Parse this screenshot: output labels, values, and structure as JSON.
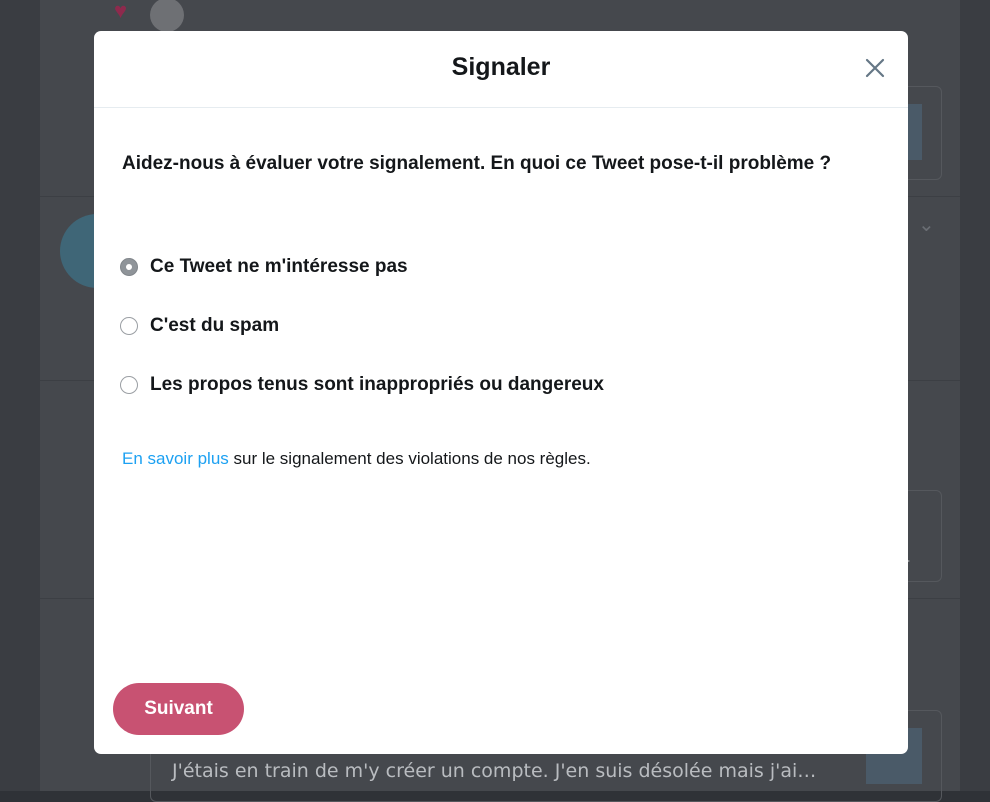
{
  "background": {
    "tweet_text": "J'étais en train de m'y créer un compte. J'en suis désolée mais j'ai…"
  },
  "modal": {
    "title": "Signaler",
    "question": "Aidez-nous à évaluer votre signalement. En quoi ce Tweet pose-t-il problème ?",
    "options": [
      {
        "label": "Ce Tweet ne m'intéresse pas",
        "selected": true
      },
      {
        "label": "C'est du spam",
        "selected": false
      },
      {
        "label": "Les propos tenus sont inappropriés ou dangereux",
        "selected": false
      }
    ],
    "learn_more_link": "En savoir plus",
    "learn_more_text": " sur le signalement des violations de nos règles.",
    "next_button": "Suivant"
  },
  "colors": {
    "accent_button": "#c85272",
    "link": "#1da1f2"
  },
  "icons": {
    "close": "close-icon",
    "heart": "heart-icon",
    "chevron": "chevron-down-icon"
  }
}
